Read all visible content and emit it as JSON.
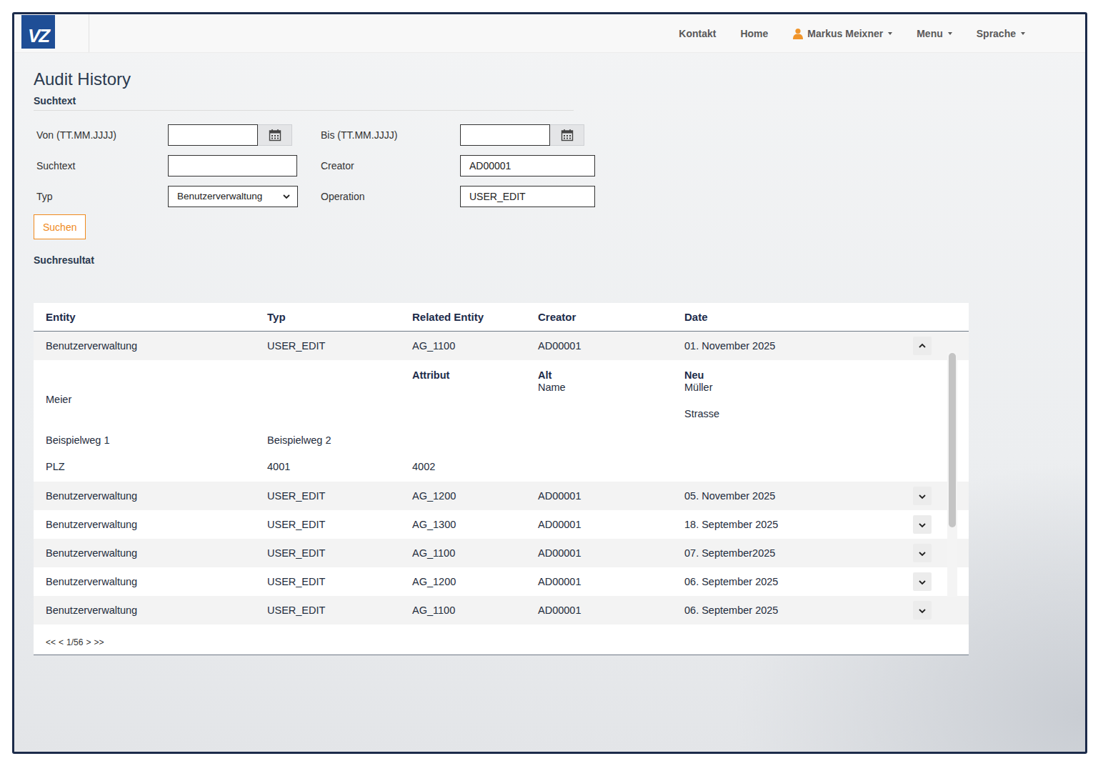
{
  "nav": {
    "logo": "VZ",
    "items": [
      {
        "label": "Kontakt",
        "kind": "link"
      },
      {
        "label": "Home",
        "kind": "link"
      },
      {
        "label": "Markus Meixner",
        "kind": "user"
      },
      {
        "label": "Menu",
        "kind": "dropdown"
      },
      {
        "label": "Sprache",
        "kind": "dropdown"
      }
    ]
  },
  "page": {
    "title": "Audit History"
  },
  "search": {
    "title": "Suchtext",
    "fields": [
      {
        "label": "Von (TT.MM.JJJJ)",
        "value": "",
        "kind": "date"
      },
      {
        "label": "Bis (TT.MM.JJJJ)",
        "value": "",
        "kind": "date"
      },
      {
        "label": "Suchtext",
        "value": "",
        "kind": "text"
      },
      {
        "label": "Creator",
        "value": "AD00001",
        "kind": "text"
      },
      {
        "label": "Typ",
        "value": "Benutzerverwaltung",
        "kind": "select"
      },
      {
        "label": "Operation",
        "value": "USER_EDIT",
        "kind": "text"
      }
    ],
    "button": "Suchen"
  },
  "results": {
    "title": "Suchresultat",
    "columns": [
      "Entity",
      "Typ",
      "Related Entity",
      "Creator",
      "Date"
    ],
    "rows": [
      {
        "cells": [
          "Benutzerverwaltung",
          "USER_EDIT",
          "AG_1100",
          "AD00001",
          "01. November 2025"
        ],
        "expanded": true,
        "details": {
          "columns": [
            "Attribut",
            "Alt",
            "Neu"
          ],
          "rows": [
            [
              "Name",
              "Müller",
              "Meier"
            ],
            [
              "Strasse",
              "Beispielweg 1",
              "Beispielweg 2"
            ],
            [
              "PLZ",
              "4001",
              "4002"
            ]
          ]
        }
      },
      {
        "cells": [
          "Benutzerverwaltung",
          "USER_EDIT",
          "AG_1200",
          "AD00001",
          "05. November 2025"
        ],
        "expanded": false
      },
      {
        "cells": [
          "Benutzerverwaltung",
          "USER_EDIT",
          "AG_1300",
          "AD00001",
          "18. September 2025"
        ],
        "expanded": false
      },
      {
        "cells": [
          "Benutzerverwaltung",
          "USER_EDIT",
          "AG_1100",
          "AD00001",
          "07. September2025"
        ],
        "expanded": false
      },
      {
        "cells": [
          "Benutzerverwaltung",
          "USER_EDIT",
          "AG_1200",
          "AD00001",
          "06. September 2025"
        ],
        "expanded": false
      },
      {
        "cells": [
          "Benutzerverwaltung",
          "USER_EDIT",
          "AG_1100",
          "AD00001",
          "06. September 2025"
        ],
        "expanded": false
      }
    ],
    "scrollbar": {
      "level": 0.72
    },
    "pagination": [
      "<<",
      "<",
      "1/56",
      ">",
      ">>"
    ]
  }
}
